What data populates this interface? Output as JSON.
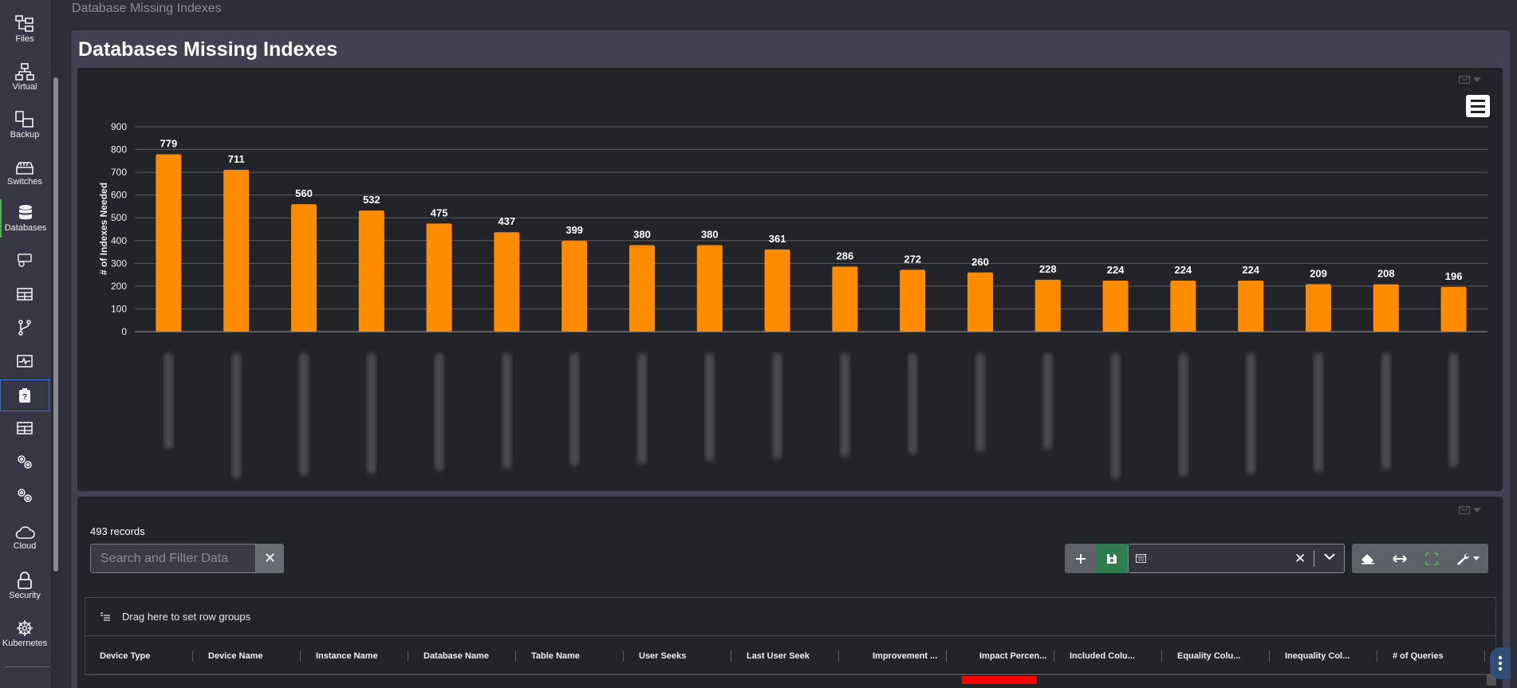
{
  "breadcrumb": "Database Missing Indexes",
  "page_title": "Databases Missing Indexes",
  "sidebar": {
    "items": [
      {
        "label": "Files",
        "icon": "files-icon"
      },
      {
        "label": "Virtual",
        "icon": "network-icon"
      },
      {
        "label": "Backup",
        "icon": "backup-icon"
      },
      {
        "label": "Switches",
        "icon": "switch-icon"
      },
      {
        "label": "Databases",
        "icon": "database-icon"
      },
      {
        "label": "",
        "icon": "server-settings-icon"
      },
      {
        "label": "",
        "icon": "table-icon"
      },
      {
        "label": "",
        "icon": "branch-icon"
      },
      {
        "label": "",
        "icon": "monitor-pulse-icon"
      },
      {
        "label": "",
        "icon": "clipboard-question-icon"
      },
      {
        "label": "",
        "icon": "table-icon"
      },
      {
        "label": "",
        "icon": "gears-icon"
      },
      {
        "label": "",
        "icon": "gears-icon"
      },
      {
        "label": "Cloud",
        "icon": "cloud-icon"
      },
      {
        "label": "Security",
        "icon": "lock-icon"
      },
      {
        "label": "Kubernetes",
        "icon": "helm-icon"
      }
    ]
  },
  "chart_data": {
    "type": "bar",
    "title": "",
    "xlabel": "",
    "ylabel": "# of Indexes Needed",
    "ylim": [
      0,
      900
    ],
    "yticks": [
      0,
      100,
      200,
      300,
      400,
      500,
      600,
      700,
      800,
      900
    ],
    "categories": [
      "",
      "",
      "",
      "",
      "",
      "",
      "",
      "",
      "",
      "",
      "",
      "",
      "",
      "",
      "",
      "",
      "",
      "",
      "",
      ""
    ],
    "values": [
      779,
      711,
      560,
      532,
      475,
      437,
      399,
      380,
      380,
      361,
      286,
      272,
      260,
      228,
      224,
      224,
      224,
      209,
      208,
      196
    ],
    "bar_color": "#ff8c00",
    "grid": true,
    "data_labels": true
  },
  "grid": {
    "records_text": "493 records",
    "search_placeholder": "Search and Filter Data",
    "group_bar_text": "Drag here to set row groups",
    "columns": [
      "Device Type",
      "Device Name",
      "Instance Name",
      "Database Name",
      "Table Name",
      "User Seeks",
      "Last User Seek",
      "Improvement ...",
      "Impact Percen...",
      "Included Colu...",
      "Equality Colu...",
      "Inequality Col...",
      "# of Queries"
    ]
  },
  "colors": {
    "accent_green": "#4caf50",
    "bar_orange": "#ff8c00",
    "impact_red": "#ff0000",
    "save_green": "#2e7d4f"
  }
}
